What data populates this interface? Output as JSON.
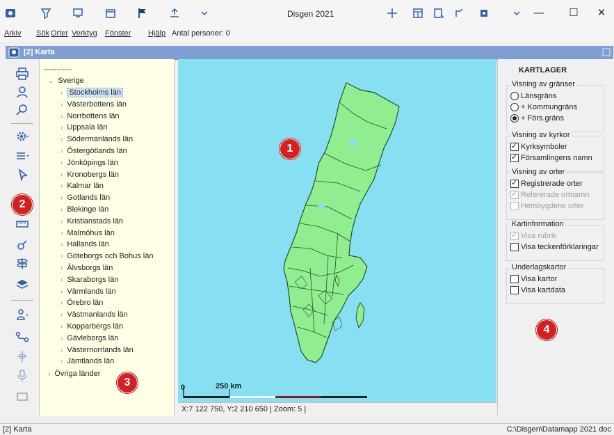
{
  "app": {
    "title": "Disgen 2021"
  },
  "menu": {
    "items": [
      "Arkiv",
      "Sök",
      "Orter",
      "Verktyg",
      "Fönster",
      "Hjälp"
    ],
    "persons": "Antal personer: 0"
  },
  "window": {
    "title": "[2] Karta"
  },
  "tree": {
    "dashes": "-----------",
    "root": "Sverige",
    "counties": [
      "Stockholms län",
      "Västerbottens län",
      "Norrbottens län",
      "Uppsala län",
      "Södermanlands län",
      "Östergötlands län",
      "Jönköpings län",
      "Kronobergs län",
      "Kalmar län",
      "Gotlands län",
      "Blekinge län",
      "Kristianstads län",
      "Malmöhus län",
      "Hallands län",
      "Göteborgs och Bohus län",
      "Älvsborgs län",
      "Skaraborgs län",
      "Värmlands län",
      "Örebro län",
      "Västmanlands län",
      "Kopparbergs län",
      "Gävleborgs län",
      "Västernorrlands län",
      "Jämtlands län"
    ],
    "other": "Övriga länder"
  },
  "map": {
    "scale_zero": "0",
    "scale_label": "250 km",
    "coords": "X:7 122 750, Y:2 210 650  |  Zoom: 5  |",
    "land_color": "#90ee90",
    "water_color": "#87e0f2"
  },
  "panel": {
    "title": "KARTLAGER",
    "groups": [
      {
        "title": "Visning av gränser",
        "options": [
          {
            "label": "Länsgräns",
            "type": "radio",
            "checked": false,
            "disabled": false
          },
          {
            "label": "+ Kommungräns",
            "type": "radio",
            "checked": false,
            "disabled": false
          },
          {
            "label": "+ Förs.gräns",
            "type": "radio",
            "checked": true,
            "disabled": false
          }
        ]
      },
      {
        "title": "Visning av kyrkor",
        "options": [
          {
            "label": "Kyrksymboler",
            "type": "checkbox",
            "checked": true,
            "disabled": false
          },
          {
            "label": "Församlingens namn",
            "type": "checkbox",
            "checked": true,
            "disabled": false
          }
        ]
      },
      {
        "title": "Visning av orter",
        "options": [
          {
            "label": "Registrerade orter",
            "type": "checkbox",
            "checked": true,
            "disabled": false
          },
          {
            "label": "Refererade ortnamn",
            "type": "checkbox",
            "checked": true,
            "disabled": true
          },
          {
            "label": "Hembygdens orter",
            "type": "checkbox",
            "checked": false,
            "disabled": true
          }
        ]
      },
      {
        "title": "Kartinformation",
        "options": [
          {
            "label": "Visa rubrik",
            "type": "checkbox",
            "checked": true,
            "disabled": true
          },
          {
            "label": "Visa teckenförklaringar",
            "type": "checkbox",
            "checked": false,
            "disabled": false
          }
        ]
      },
      {
        "title": "Underlagskartor",
        "options": [
          {
            "label": "Visa kartor",
            "type": "checkbox",
            "checked": false,
            "disabled": false
          },
          {
            "label": "Visa kartdata",
            "type": "checkbox",
            "checked": false,
            "disabled": false
          }
        ]
      }
    ]
  },
  "badges": [
    "1",
    "2",
    "3",
    "4"
  ],
  "status": {
    "left": "[2] Karta",
    "right": "C:\\Disgen\\Datamapp 2021 doc"
  }
}
